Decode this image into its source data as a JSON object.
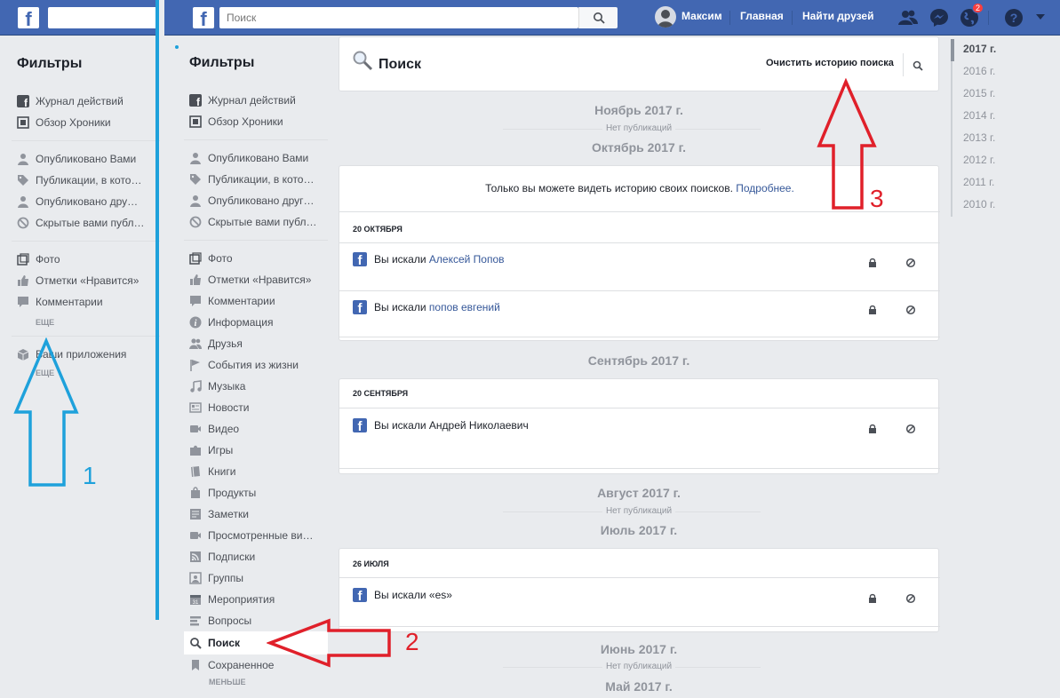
{
  "left_panel": {
    "filters_title": "Фильтры",
    "items_group1": [
      "Журнал действий",
      "Обзор Хроники"
    ],
    "items_group2": [
      "Опубликовано Вами",
      "Публикации, в кото…",
      "Опубликовано дру…",
      "Скрытые вами публ…"
    ],
    "items_group3": [
      "Фото",
      "Отметки «Нравится»",
      "Комментарии"
    ],
    "more1": "ЕЩЕ",
    "apps": "Ваши приложения",
    "more2": "ЕЩЕ"
  },
  "header": {
    "search_placeholder": "Поиск",
    "user_name": "Максим",
    "home": "Главная",
    "find_friends": "Найти друзей",
    "notifications_count": "2"
  },
  "sidebar": {
    "filters_title": "Фильтры",
    "group1": [
      "Журнал действий",
      "Обзор Хроники"
    ],
    "group2": [
      "Опубликовано Вами",
      "Публикации, в кото…",
      "Опубликовано друг…",
      "Скрытые вами публ…"
    ],
    "group3": [
      "Фото",
      "Отметки «Нравится»",
      "Комментарии",
      "Информация",
      "Друзья",
      "События из жизни",
      "Музыка",
      "Новости",
      "Видео",
      "Игры",
      "Книги",
      "Продукты",
      "Заметки",
      "Просмотренные ви…",
      "Подписки",
      "Группы",
      "Мероприятия",
      "Вопросы"
    ],
    "active_item": "Поиск",
    "saved": "Сохраненное",
    "less": "МЕНЬШЕ"
  },
  "main": {
    "title": "Поиск",
    "clear_history": "Очистить историю поиска",
    "privacy_note": "Только вы можете видеть историю своих поисков.",
    "learn_more": "Подробнее.",
    "no_posts": "Нет публикаций",
    "months": {
      "nov": "Ноябрь 2017 г.",
      "oct": "Октябрь 2017 г.",
      "sep": "Сентябрь 2017 г.",
      "aug": "Август 2017 г.",
      "jul": "Июль 2017 г.",
      "jun": "Июнь 2017 г.",
      "may": "Май 2017 г."
    },
    "days": {
      "oct20": "20 ОКТЯБРЯ",
      "sep20": "20 СЕНТЯБРЯ",
      "jul26": "26 ИЮЛЯ"
    },
    "searched_prefix": "Вы искали",
    "entries": {
      "e1": "Алексей Попов",
      "e2": "попов евгений",
      "e3": "Вы искали Андрей Николаевич",
      "e4": "Вы искали «es»"
    }
  },
  "years": [
    "2017 г.",
    "2016 г.",
    "2015 г.",
    "2014 г.",
    "2013 г.",
    "2012 г.",
    "2011 г.",
    "2010 г."
  ],
  "annotations": {
    "n1": "1",
    "n2": "2",
    "n3": "3"
  },
  "colors": {
    "brand": "#4267b2",
    "annotation_blue": "#1ea1db",
    "annotation_red": "#e0202a"
  }
}
